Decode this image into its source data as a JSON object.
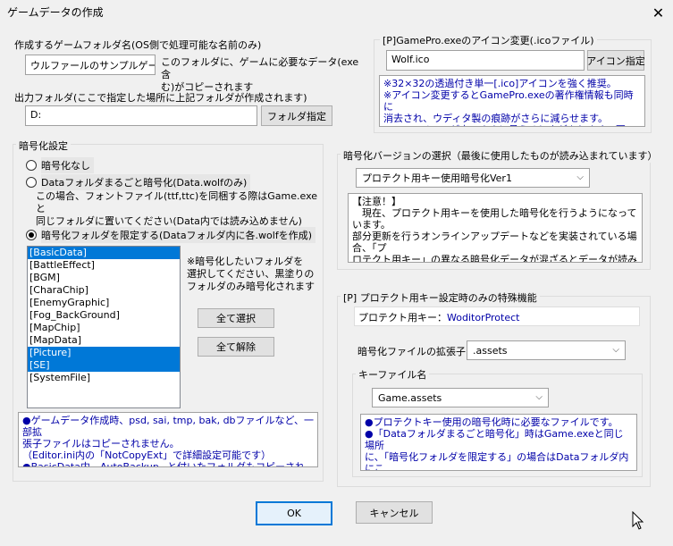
{
  "window": {
    "title": "ゲームデータの作成",
    "close_glyph": "✕"
  },
  "folder_name": {
    "label": "作成するゲームフォルダ名(OS側で処理可能な名前のみ)",
    "value": "ウルファールのサンプルゲーム",
    "note": "このフォルダに、ゲームに必要なデータ(exe含\nむ)がコピーされます"
  },
  "output_folder": {
    "label": "出力フォルダ(ここで指定した場所に上記フォルダが作成されます)",
    "value": "D:",
    "button": "フォルダ指定"
  },
  "icon_group": {
    "label": "[P]GamePro.exeのアイコン変更(.icoファイル)",
    "value": "Wolf.ico",
    "button": "アイコン指定",
    "info": "※32×32の透過付き単一[.ico]アイコンを強く推奨。\n※アイコン変更するとGamePro.exeの著作権情報も同時に\n消去され、ウディタ製の痕跡がさらに減らせます。\n※EXEアイコンが古いままに見えるときがあります、要PC再起動"
  },
  "encryption": {
    "label": "暗号化設定",
    "options": [
      {
        "label": "暗号化なし"
      },
      {
        "label": "Dataフォルダまるごと暗号化(Data.wolfのみ)"
      },
      {
        "label": "暗号化フォルダを限定する(Dataフォルダ内に各.wolfを作成)"
      }
    ],
    "data_note": "この場合、フォントファイル(ttf,ttc)を同梱する際はGame.exeと\n同じフォルダに置いてください(Data内では読み込めません)",
    "list_note": "※暗号化したいフォルダを\n選択してください、黒塗りの\nフォルダのみ暗号化されます",
    "folders": [
      {
        "name": "[BasicData]",
        "selected": true
      },
      {
        "name": "[BattleEffect]",
        "selected": false
      },
      {
        "name": "[BGM]",
        "selected": false
      },
      {
        "name": "[CharaChip]",
        "selected": false
      },
      {
        "name": "[EnemyGraphic]",
        "selected": false
      },
      {
        "name": "[Fog_BackGround]",
        "selected": false
      },
      {
        "name": "[MapChip]",
        "selected": false
      },
      {
        "name": "[MapData]",
        "selected": false
      },
      {
        "name": "[Picture]",
        "selected": true
      },
      {
        "name": "[SE]",
        "selected": true
      },
      {
        "name": "[SystemFile]",
        "selected": false
      }
    ],
    "select_all": "全て選択",
    "deselect_all": "全て解除",
    "info": "●ゲームデータ作成時、psd, sai, tmp, bak, dbファイルなど、一部拡\n張子ファイルはコピーされません。\n（Editor.ini内の「NotCopyExt」で詳細設定可能です）\n●BasicData内、AutoBackup~と付いたフォルダもコピーされません。"
  },
  "version_group": {
    "label": "暗号化バージョンの選択（最後に使用したものが読み込まれています）",
    "selected": "プロテクト用キー使用暗号化Ver1",
    "notice_title": "【注意！】",
    "notice": "　現在、プロテクト用キーを使用した暗号化を行うようになっています。\n部分更新を行うオンラインアップデートなどを実装されている場合、「プ\nロテクト用キー」の異なる暗号化データが混ざるとデータが読み込めな\nくなりますのでご注意ください。"
  },
  "protect_group": {
    "label": "[P] プロテクト用キー設定時のみの特殊機能",
    "key_label": "プロテクト用キー：",
    "key_value": "WoditorProtect",
    "ext_label": "暗号化ファイルの拡張子",
    "ext_value": ".assets",
    "keyfile_label": "キーファイル名",
    "keyfile_value": "Game.assets",
    "keyfile_info": "●プロテクトキー使用の暗号化時に必要なファイルです。\n●「Dataフォルダまるごと暗号化」時はGame.exeと同じ場所\nに、「暗号化フォルダを限定する」の場合はDataフォルダ内にこ\nのキーファイルが作られます。"
  },
  "footer": {
    "ok": "OK",
    "cancel": "キャンセル"
  }
}
